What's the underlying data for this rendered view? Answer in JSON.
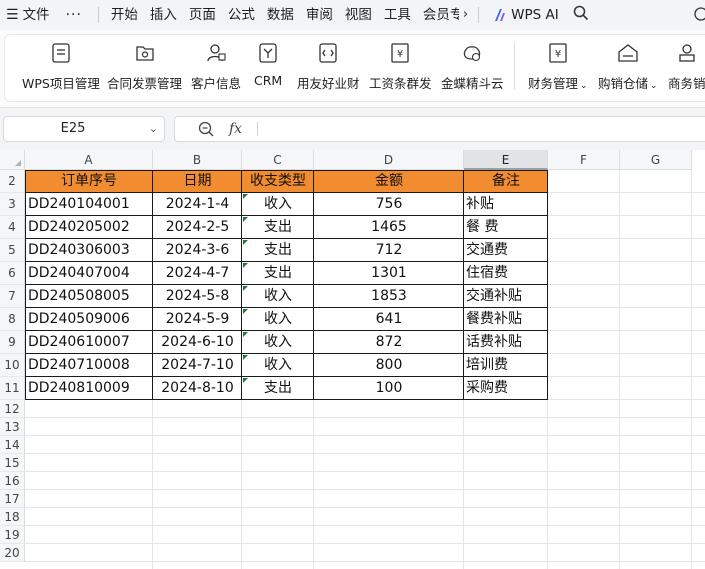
{
  "menu": {
    "items": [
      "文件",
      "开始",
      "插入",
      "页面",
      "公式",
      "数据",
      "审阅",
      "视图",
      "工具",
      "会员专"
    ],
    "ai_label": "WPS AI"
  },
  "ribbon": {
    "items": [
      {
        "label": "WPS项目管理",
        "icon": "project-icon"
      },
      {
        "label": "合同发票管理",
        "icon": "invoice-icon"
      },
      {
        "label": "客户信息",
        "icon": "customer-icon"
      },
      {
        "label": "CRM",
        "icon": "crm-icon"
      },
      {
        "label": "用友好业财",
        "icon": "yonyou-icon"
      },
      {
        "label": "工资条群发",
        "icon": "payslip-icon"
      },
      {
        "label": "金蝶精斗云",
        "icon": "kingdee-icon"
      },
      {
        "label": "财务管理",
        "icon": "finance-icon"
      },
      {
        "label": "购销仓储",
        "icon": "warehouse-icon"
      },
      {
        "label": "商务销",
        "icon": "business-icon"
      }
    ]
  },
  "formula_bar": {
    "name_box": "E25",
    "fx": "fx",
    "formula": ""
  },
  "sheet": {
    "columns": [
      "A",
      "B",
      "C",
      "D",
      "E",
      "F",
      "G"
    ],
    "selected_column": "E",
    "rows": [
      "2",
      "3",
      "4",
      "5",
      "6",
      "7",
      "8",
      "9",
      "10",
      "11",
      "12",
      "13",
      "14",
      "15",
      "16",
      "17",
      "18",
      "19",
      "20"
    ],
    "header_color": "#f28c30",
    "table": {
      "headers": [
        "订单序号",
        "日期",
        "收支类型",
        "金额",
        "备注"
      ],
      "records": [
        [
          "DD240104001",
          "2024-1-4",
          "收入",
          "756",
          "补贴"
        ],
        [
          "DD240205002",
          "2024-2-5",
          "支出",
          "1465",
          "餐 费"
        ],
        [
          "DD240306003",
          "2024-3-6",
          "支出",
          "712",
          "交通费"
        ],
        [
          "DD240407004",
          "2024-4-7",
          "支出",
          "1301",
          "住宿费"
        ],
        [
          "DD240508005",
          "2024-5-8",
          "收入",
          "1853",
          "交通补贴"
        ],
        [
          "DD240509006",
          "2024-5-9",
          "收入",
          "641",
          "餐费补贴"
        ],
        [
          "DD240610007",
          "2024-6-10",
          "收入",
          "872",
          "话费补贴"
        ],
        [
          "DD240710008",
          "2024-7-10",
          "收入",
          "800",
          "培训费"
        ],
        [
          "DD240810009",
          "2024-8-10",
          "支出",
          "100",
          "采购费"
        ]
      ]
    }
  }
}
